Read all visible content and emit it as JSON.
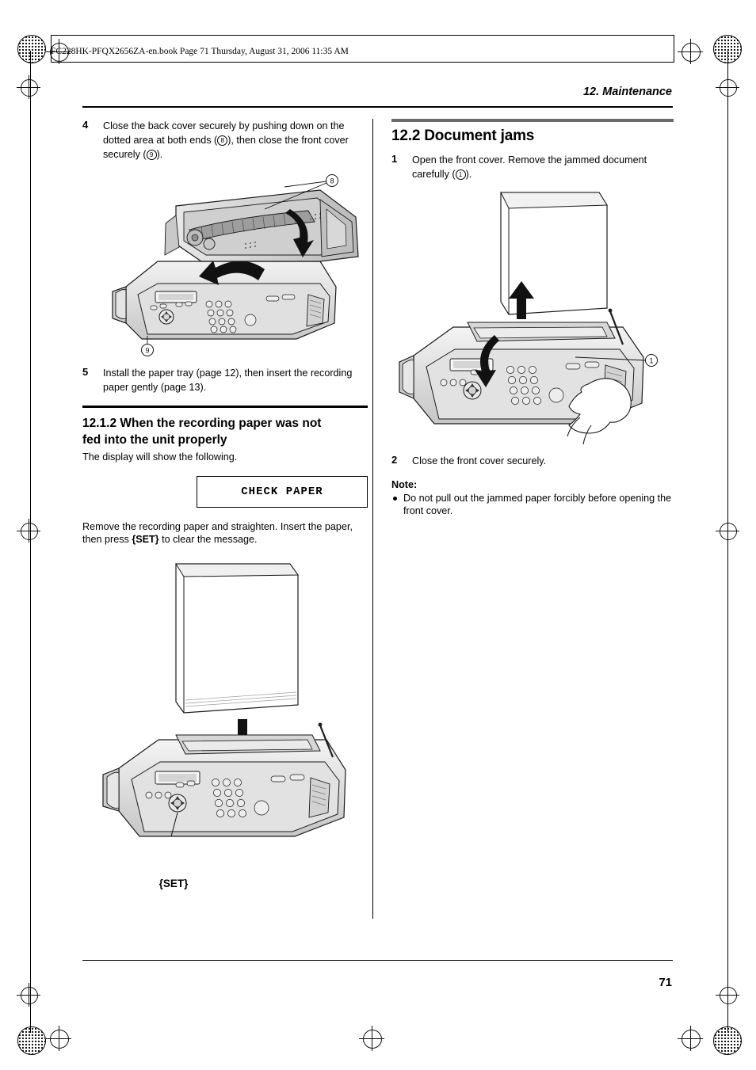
{
  "file_header": "FC228HK-PFQX2656ZA-en.book  Page 71  Thursday, August 31, 2006  11:35 AM",
  "running_head": "12. Maintenance",
  "page_number": "71",
  "left_column": {
    "step4": {
      "num": "4",
      "text_a": "Close the back cover securely by pushing down on the dotted area at both ends (",
      "circle_a": "8",
      "text_b": "), then close the front cover securely (",
      "circle_b": "9",
      "text_c": ")."
    },
    "figure1": {
      "callout_top": "8",
      "callout_bottom": "9"
    },
    "step5": {
      "num": "5",
      "text": "Install the paper tray (page 12), then insert the recording paper gently (page 13)."
    },
    "subsection": {
      "title_line1": "12.1.2 When the recording paper was not",
      "title_line2": "fed into the unit properly",
      "intro": "The display will show the following.",
      "lcd_text": "CHECK PAPER",
      "after_text_a": "Remove the recording paper and straighten. Insert the paper, then press ",
      "after_text_key": "{SET}",
      "after_text_b": " to clear the message."
    },
    "figure2": {
      "set_label": "{SET}"
    }
  },
  "right_column": {
    "section": {
      "title": "12.2 Document jams"
    },
    "step1": {
      "num": "1",
      "text_a": "Open the front cover. Remove the jammed document carefully (",
      "circle": "1",
      "text_b": ")."
    },
    "figure3": {
      "callout": "1"
    },
    "step2": {
      "num": "2",
      "text": "Close the front cover securely."
    },
    "note": {
      "title": "Note:",
      "bullet1": "Do not pull out the jammed paper forcibly before opening the front cover."
    }
  },
  "colors": {
    "section_rule": "#6b6b6b",
    "text": "#000000",
    "device_body": "#d9d9d9",
    "device_shade": "#bdbdbd"
  }
}
